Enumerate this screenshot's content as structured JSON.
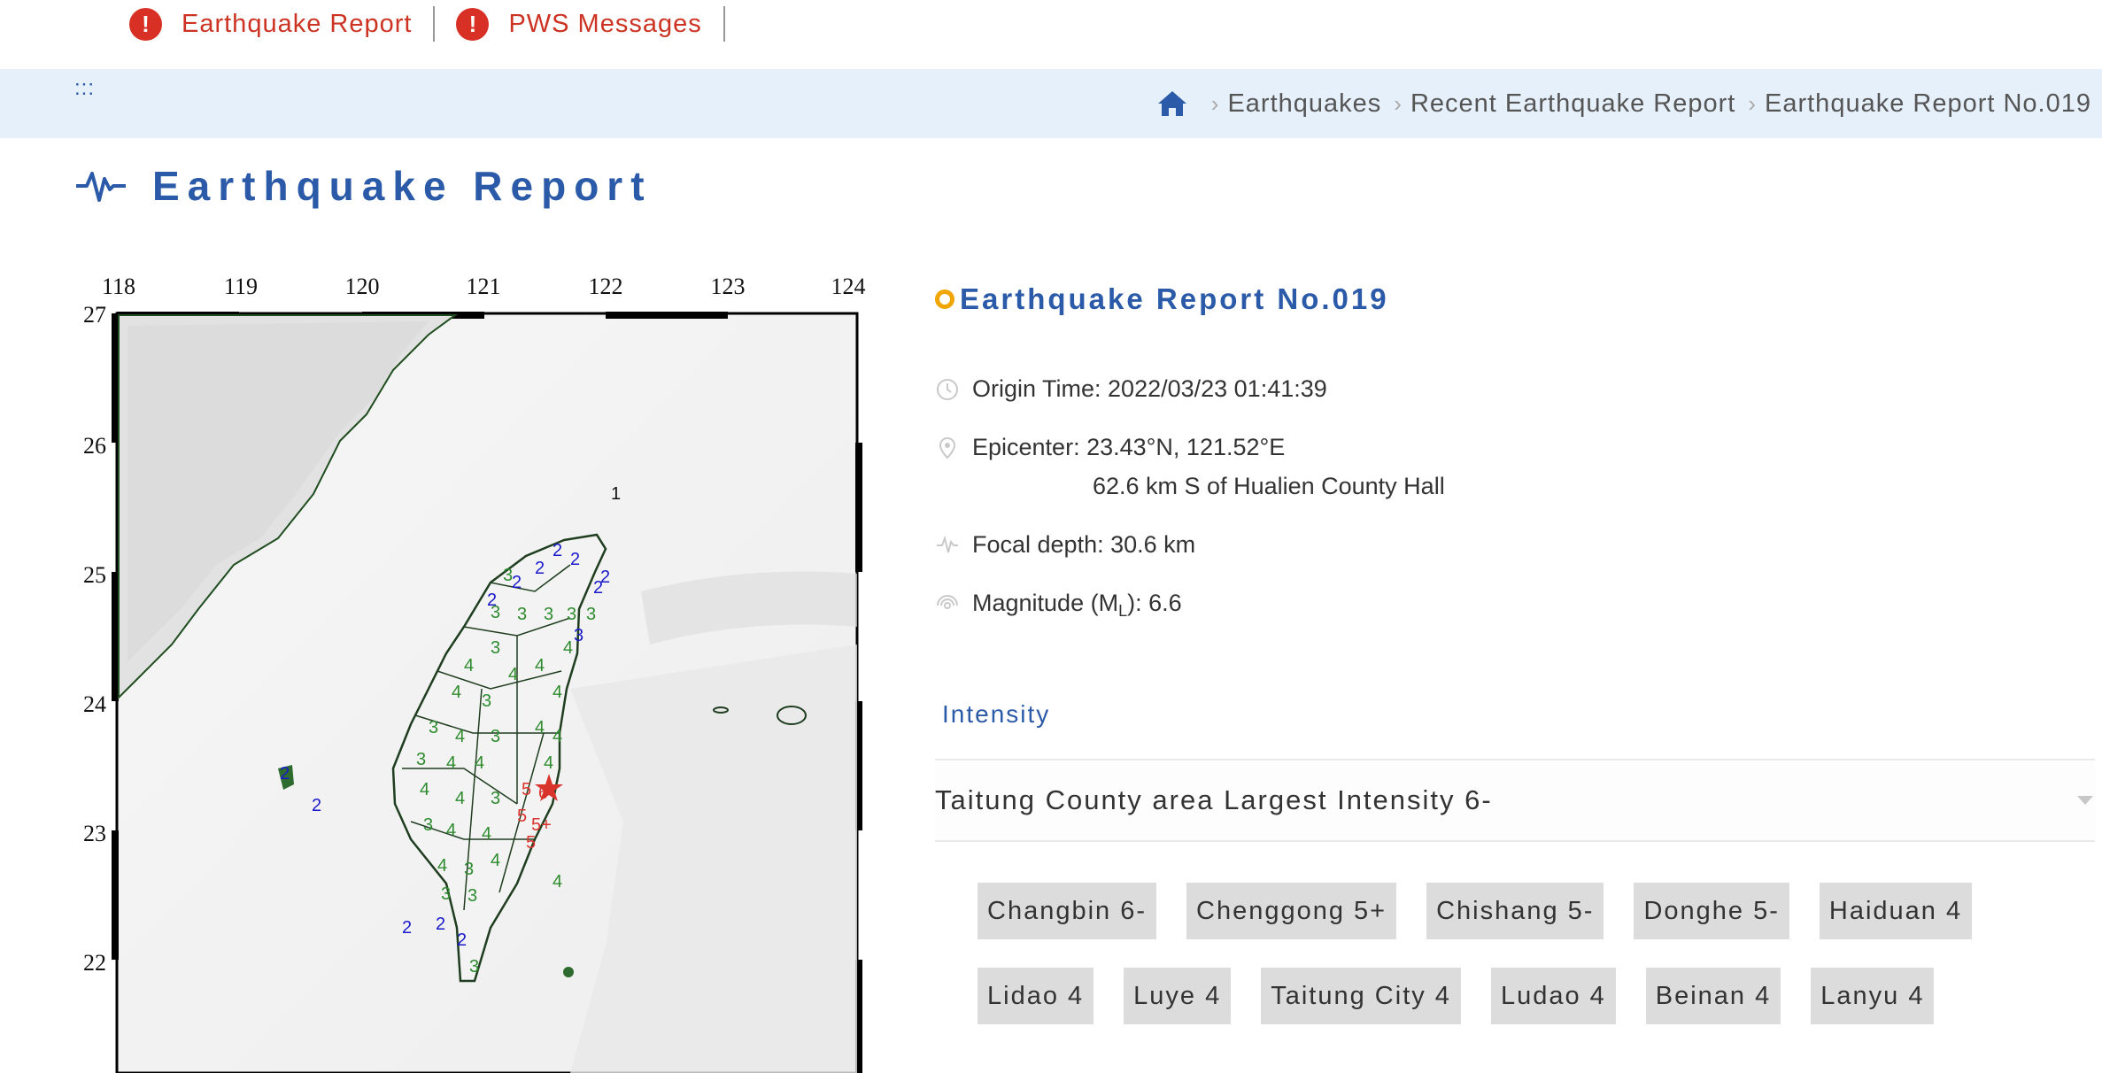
{
  "alerts": [
    {
      "label": "Earthquake Report"
    },
    {
      "label": "PWS Messages"
    }
  ],
  "breadcrumb": {
    "accesskey": ":::",
    "items": [
      "Earthquakes",
      "Recent Earthquake Report",
      "Earthquake Report No.019"
    ]
  },
  "page": {
    "title": "Earthquake Report"
  },
  "map": {
    "lon_ticks": [
      "118",
      "119",
      "120",
      "121",
      "122",
      "123",
      "124"
    ],
    "lat_ticks": [
      "27",
      "26",
      "25",
      "24",
      "23",
      "22"
    ]
  },
  "report": {
    "title": "Earthquake Report No.019",
    "origin_time": "Origin Time: 2022/03/23 01:41:39",
    "epicenter": "Epicenter: 23.43°N, 121.52°E",
    "epicenter_detail": "62.6 km S of Hualien County Hall",
    "focal_depth": "Focal depth: 30.6 km",
    "magnitude_prefix": "Magnitude (M",
    "magnitude_sub": "L",
    "magnitude_suffix": "): 6.6"
  },
  "intensity": {
    "tab_label": "Intensity",
    "area_label": "Taitung County area Largest Intensity 6-",
    "stations": [
      "Changbin 6-",
      "Chenggong 5+",
      "Chishang 5-",
      "Donghe 5-",
      "Haiduan 4",
      "Lidao 4",
      "Luye 4",
      "Taitung City 4",
      "Ludao 4",
      "Beinan 4",
      "Lanyu 4"
    ]
  },
  "colors": {
    "accent_blue": "#2a5aa8",
    "alert_red": "#cc3322",
    "ring_orange": "#f0a500",
    "intensity_green": "#2e8b2e",
    "intensity_blue": "#1a1acc",
    "intensity_red": "#d9342b"
  },
  "icons": {
    "alert": "exclamation-circle-icon",
    "home": "home-icon",
    "title": "pulse-icon",
    "origin": "clock-icon",
    "epicenter": "map-pin-icon",
    "depth": "seismic-wave-icon",
    "magnitude": "radar-icon"
  }
}
